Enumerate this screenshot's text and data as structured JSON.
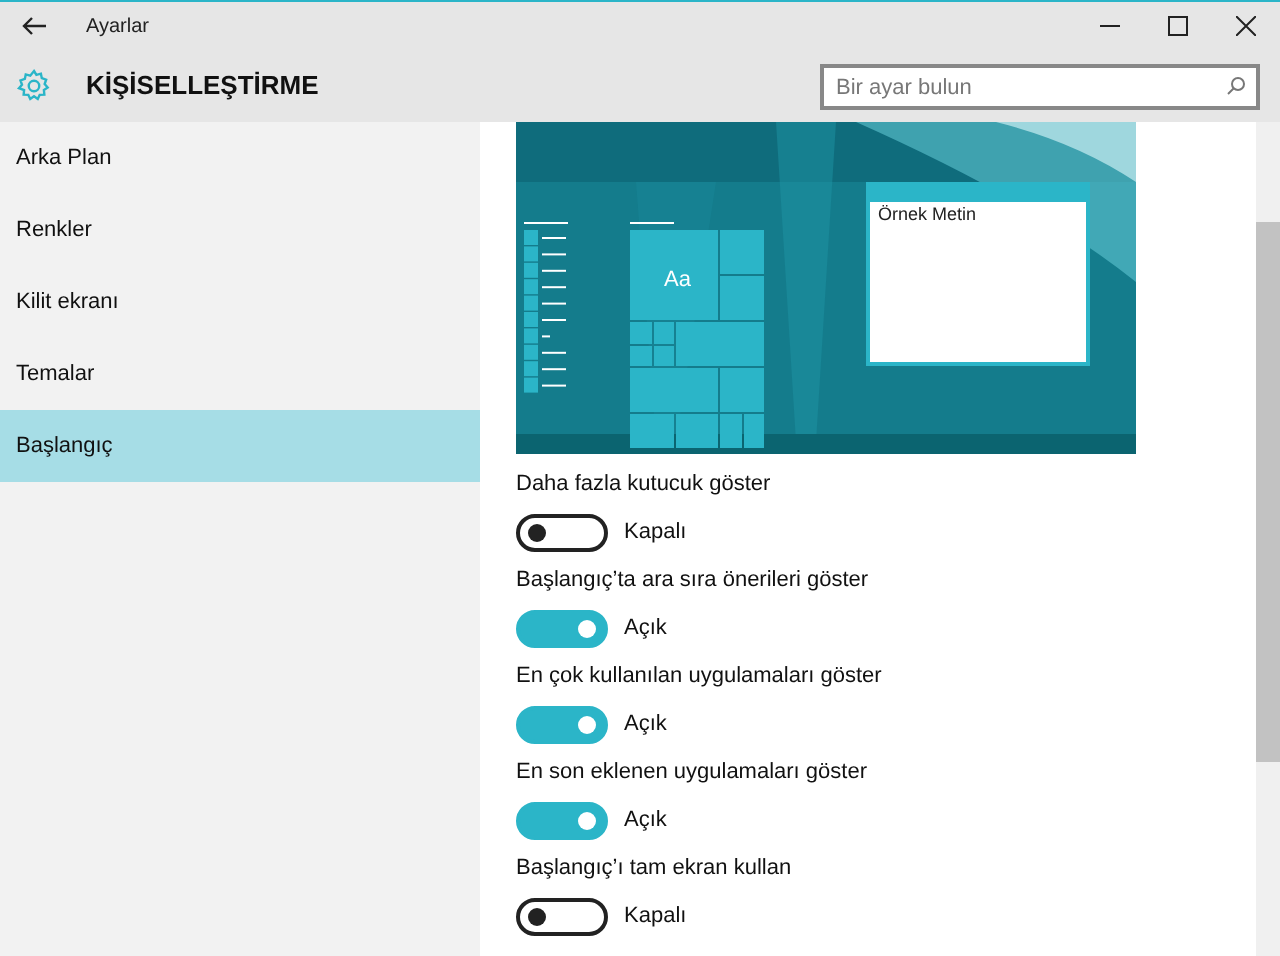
{
  "window": {
    "title": "Ayarlar"
  },
  "header": {
    "title": "KİŞİSELLEŞTİRME",
    "search": {
      "placeholder": "Bir ayar bulun"
    }
  },
  "sidebar": {
    "items": [
      {
        "label": "Arka Plan",
        "selected": false
      },
      {
        "label": "Renkler",
        "selected": false
      },
      {
        "label": "Kilit ekranı",
        "selected": false
      },
      {
        "label": "Temalar",
        "selected": false
      },
      {
        "label": "Başlangıç",
        "selected": true
      }
    ]
  },
  "preview": {
    "tile_label": "Aa",
    "sample_text": "Örnek Metin"
  },
  "settings": [
    {
      "label": "Daha fazla kutucuk göster",
      "on": false,
      "state": "Kapalı"
    },
    {
      "label": "Başlangıç’ta ara sıra önerileri göster",
      "on": true,
      "state": "Açık"
    },
    {
      "label": "En çok kullanılan uygulamaları göster",
      "on": true,
      "state": "Açık"
    },
    {
      "label": "En son eklenen uygulamaları göster",
      "on": true,
      "state": "Açık"
    },
    {
      "label": "Başlangıç’ı tam ekran kullan",
      "on": false,
      "state": "Kapalı"
    }
  ]
}
